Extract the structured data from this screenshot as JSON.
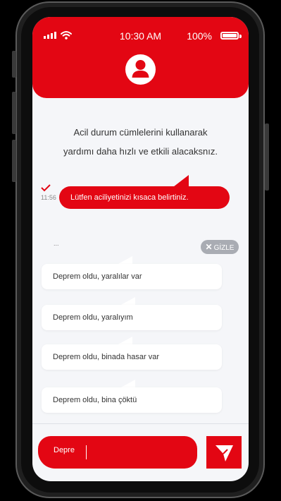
{
  "status_bar": {
    "time": "10:30 AM",
    "battery_percent": "100%"
  },
  "info_text": {
    "line1": "Acil durum cümlelerini kullanarak",
    "line2": "yardımı daha hızlı ve etkili alacaksnız."
  },
  "message": {
    "time": "11:56",
    "text": "Lütfen aciliyetinizi kısaca belirtiniz."
  },
  "typing_indicator": "...",
  "hide_button": {
    "label": "GİZLE"
  },
  "suggestions": [
    "Deprem oldu, yaralılar var",
    "Deprem oldu, yaralıyım",
    "Deprem oldu, binada hasar var",
    "Deprem oldu, bina çöktü"
  ],
  "composer": {
    "value": "Depre"
  },
  "colors": {
    "accent": "#e30613",
    "background": "#f5f6f9",
    "hide_button": "#a9acb3"
  },
  "icons": {
    "avatar": "user-icon",
    "send": "send-icon",
    "check": "check-icon",
    "close": "close-icon"
  }
}
